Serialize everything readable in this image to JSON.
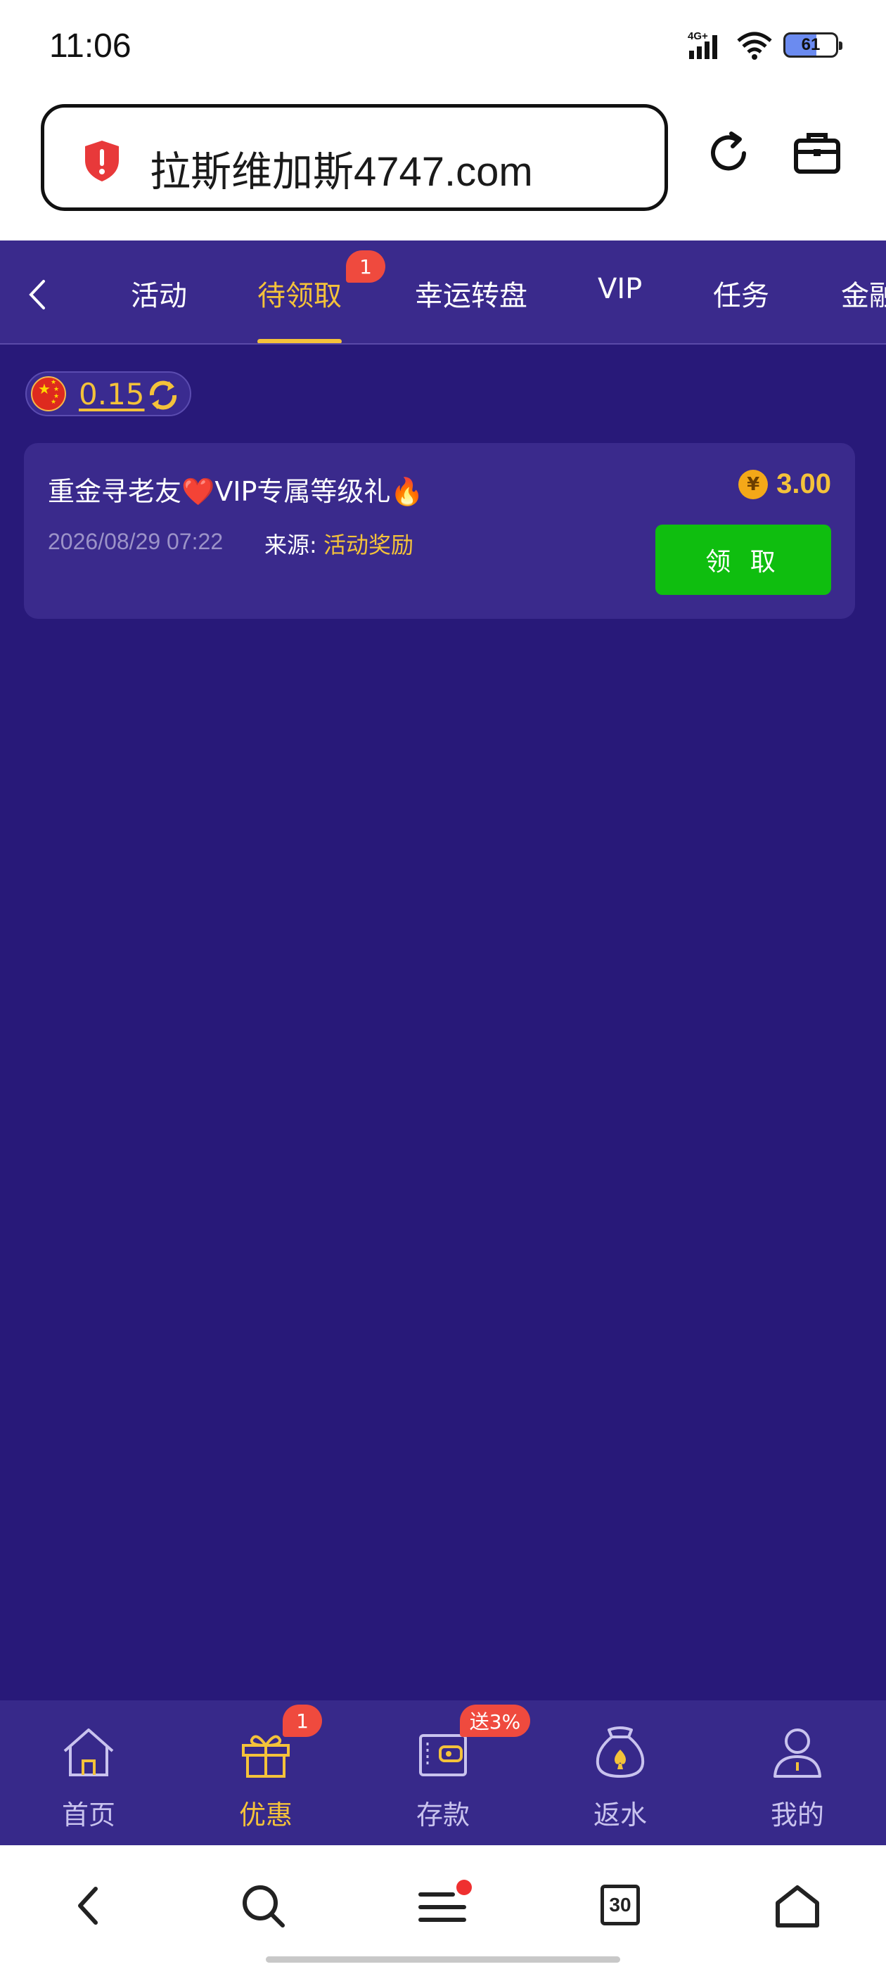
{
  "status_bar": {
    "time": "11:06",
    "network": "4G+",
    "battery": "61"
  },
  "browser": {
    "url": "拉斯维加斯4747.com",
    "shield_icon": "warning-shield-icon",
    "refresh_icon": "refresh-icon",
    "briefcase_icon": "briefcase-icon"
  },
  "tabs": {
    "items": [
      "活动",
      "待领取",
      "幸运转盘",
      "VIP",
      "任务",
      "金融"
    ],
    "active_index": 1,
    "badge": "1"
  },
  "balance": {
    "value": "0.15"
  },
  "reward_card": {
    "title": "重金寻老友❤️VIP专属等级礼🔥",
    "date": "2026/08/29 07:22",
    "source_label": "来源:",
    "source": "活动奖励",
    "amount": "3.00",
    "coin_symbol": "¥",
    "claim_label": "领 取"
  },
  "bottom_nav": {
    "items": [
      {
        "label": "首页",
        "icon": "home-icon"
      },
      {
        "label": "优惠",
        "icon": "gift-icon",
        "badge": "1"
      },
      {
        "label": "存款",
        "icon": "wallet-icon",
        "badge": "送3%"
      },
      {
        "label": "返水",
        "icon": "money-bag-icon"
      },
      {
        "label": "我的",
        "icon": "user-icon"
      }
    ],
    "active_index": 1
  },
  "browser_nav": {
    "tab_count": "30"
  },
  "colors": {
    "background": "#281979",
    "accent": "#f4c23a",
    "claim_button": "#0fbe0f",
    "badge": "#ef4a3e"
  }
}
